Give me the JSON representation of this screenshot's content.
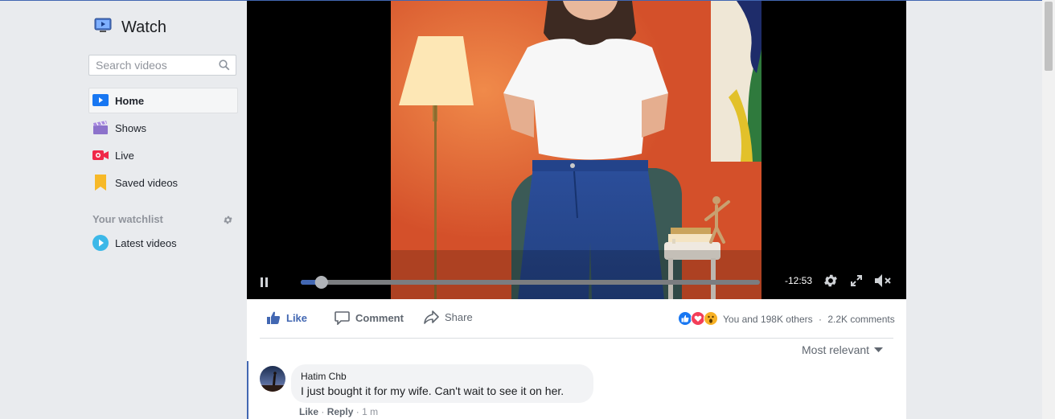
{
  "sidebar": {
    "title": "Watch",
    "search_placeholder": "Search videos",
    "items": [
      {
        "label": "Home",
        "icon": "home-play-icon",
        "active": true
      },
      {
        "label": "Shows",
        "icon": "shows-clapper-icon"
      },
      {
        "label": "Live",
        "icon": "live-camera-icon"
      },
      {
        "label": "Saved videos",
        "icon": "bookmark-icon"
      }
    ],
    "watchlist_header": "Your watchlist",
    "watchlist_items": [
      {
        "label": "Latest videos",
        "icon": "latest-play-icon"
      }
    ]
  },
  "player": {
    "state": "playing",
    "time_remaining": "-12:53",
    "progress": 0.045,
    "buffered": 0.06,
    "muted": true
  },
  "actions": {
    "like": "Like",
    "comment": "Comment",
    "share": "Share",
    "reaction_summary": "You and 198K others",
    "separator": "·",
    "comment_count": "2.2K comments",
    "sort_label": "Most relevant"
  },
  "comment": {
    "author": "Hatim Chb",
    "text": "I just bought it for my wife. Can't wait to see it on her.",
    "like_label": "Like",
    "reply_label": "Reply",
    "dot": "·",
    "time": "1 m"
  },
  "colors": {
    "brand_blue": "#4267b2",
    "like_blue": "#1877f2",
    "love_red": "#f33e58",
    "wow_yellow": "#f7b125",
    "page_bg": "#e9ebee"
  }
}
